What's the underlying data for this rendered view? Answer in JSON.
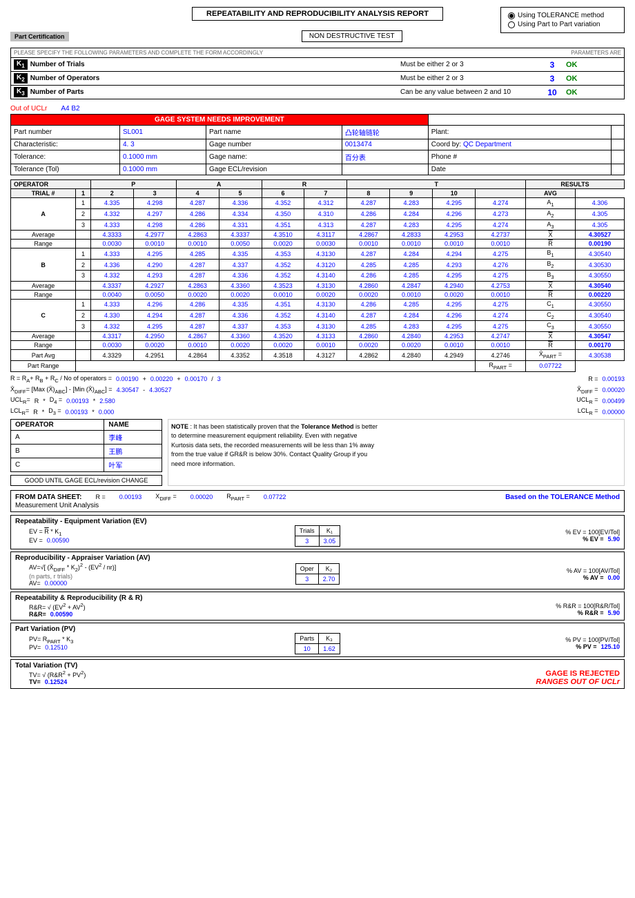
{
  "header": {
    "title": "REPEATABILITY AND REPRODUCIBILITY ANALYSIS REPORT",
    "ndt_label": "NON DESTRUCTIVE TEST",
    "part_cert": "Part Certification"
  },
  "radio_options": {
    "option1": "Using TOLERANCE method",
    "option2": "Using Part to Part variation",
    "selected": "option1"
  },
  "params_header": {
    "left": "PLEASE SPECIFY THE FOLLOWING PARAMETERS AND COMPLETE THE FORM ACCORDINGLY",
    "right": "PARAMETERS ARE"
  },
  "parameters": [
    {
      "k": "K",
      "sub": "1",
      "label": "Number of Trials",
      "desc": "Must be either 2 or 3",
      "value": "3",
      "status": "OK"
    },
    {
      "k": "K",
      "sub": "2",
      "label": "Number of Operators",
      "desc": "Must be either 2 or 3",
      "value": "3",
      "status": "OK"
    },
    {
      "k": "K",
      "sub": "3",
      "label": "Number of Parts",
      "desc": "Can be any value between 2 and 10",
      "value": "10",
      "status": "OK"
    }
  ],
  "info": {
    "out_of_uclr": "Out of UCLr",
    "a4b2": "A4 B2",
    "gage_needs": "GAGE SYSTEM NEEDS IMPROVEMENT",
    "part_number_label": "Part number",
    "part_number_value": "SL001",
    "part_name_label": "Part name",
    "part_name_value": "凸轮轴链轮",
    "plant_label": "Plant:",
    "plant_value": "",
    "characteristic_label": "Characteristic:",
    "characteristic_value": "4. 3",
    "gage_number_label": "Gage number",
    "gage_number_value": "0013474",
    "coord_by_label": "Coord by:",
    "coord_by_value": "QC Department",
    "tolerance_label": "Tolerance:",
    "tolerance_value": "0.1000",
    "tolerance_unit": "mm",
    "gage_name_label": "Gage name:",
    "gage_name_value": "百分表",
    "phone_label": "Phone #",
    "tolerance_tol_label": "Tolerance (Tol)",
    "tolerance_tol_value": "0.1000",
    "tolerance_tol_unit": "mm",
    "gage_ecl_label": "Gage ECL/revision",
    "date_label": "Date"
  },
  "table": {
    "operator_label": "OPERATOR",
    "operators": [
      "P",
      "A",
      "R",
      "T"
    ],
    "trial_label": "TRIAL #",
    "cols": [
      "1",
      "2",
      "3",
      "4",
      "5",
      "6",
      "7",
      "8",
      "9",
      "10"
    ],
    "results_label": "RESULTS",
    "avg_label": "AVG",
    "rows_A": {
      "label": "A",
      "trial1": [
        "4.335",
        "4.298",
        "4.287",
        "4.336",
        "4.352",
        "4.312",
        "4.287",
        "4.283",
        "4.295",
        "4.274"
      ],
      "trial2": [
        "4.332",
        "4.297",
        "4.286",
        "4.334",
        "4.350",
        "4.310",
        "4.286",
        "4.284",
        "4.296",
        "4.273"
      ],
      "trial3": [
        "4.333",
        "4.298",
        "4.286",
        "4.331",
        "4.351",
        "4.313",
        "4.287",
        "4.283",
        "4.295",
        "4.274"
      ],
      "avg": [
        "4.3333",
        "4.2977",
        "4.2863",
        "4.3337",
        "4.3510",
        "4.3117",
        "4.2867",
        "4.2833",
        "4.2953",
        "4.2737"
      ],
      "range": [
        "0.0030",
        "0.0010",
        "0.0010",
        "0.0050",
        "0.0020",
        "0.0030",
        "0.0010",
        "0.0010",
        "0.0010",
        "0.0010"
      ],
      "result_labels": [
        "A₁",
        "A₂",
        "A₃",
        "X̄ₐ",
        "R̄ₐ"
      ],
      "result_values": [
        "4.306",
        "4.305",
        "4.305",
        "4.30527",
        "0.00190"
      ]
    },
    "rows_B": {
      "label": "B",
      "trial1": [
        "4.333",
        "4.295",
        "4.285",
        "4.335",
        "4.353",
        "4.3130",
        "4.287",
        "4.284",
        "4.294",
        "4.275"
      ],
      "trial2": [
        "4.336",
        "4.290",
        "4.287",
        "4.337",
        "4.352",
        "4.3120",
        "4.285",
        "4.285",
        "4.293",
        "4.276"
      ],
      "trial3": [
        "4.332",
        "4.293",
        "4.287",
        "4.336",
        "4.352",
        "4.3140",
        "4.286",
        "4.285",
        "4.295",
        "4.275"
      ],
      "avg": [
        "4.3337",
        "4.2927",
        "4.2863",
        "4.3360",
        "4.3523",
        "4.3130",
        "4.2860",
        "4.2847",
        "4.2940",
        "4.2753"
      ],
      "range": [
        "0.0040",
        "0.0050",
        "0.0020",
        "0.0020",
        "0.0010",
        "0.0020",
        "0.0020",
        "0.0010",
        "0.0020",
        "0.0010"
      ],
      "result_labels": [
        "B₁",
        "B₂",
        "B₃",
        "X̄ᵦ",
        "R̄ᵦ"
      ],
      "result_values": [
        "4.30540",
        "4.30530",
        "4.30550",
        "4.30540",
        "0.00220"
      ]
    },
    "rows_C": {
      "label": "C",
      "trial1": [
        "4.333",
        "4.296",
        "4.286",
        "4.335",
        "4.351",
        "4.3130",
        "4.286",
        "4.285",
        "4.295",
        "4.275"
      ],
      "trial2": [
        "4.330",
        "4.294",
        "4.287",
        "4.336",
        "4.352",
        "4.3140",
        "4.287",
        "4.284",
        "4.296",
        "4.274"
      ],
      "trial3": [
        "4.332",
        "4.295",
        "4.287",
        "4.337",
        "4.353",
        "4.3130",
        "4.285",
        "4.283",
        "4.295",
        "4.275"
      ],
      "avg": [
        "4.3317",
        "4.2950",
        "4.2867",
        "4.3360",
        "4.3520",
        "4.3133",
        "4.2860",
        "4.2840",
        "4.2953",
        "4.2747"
      ],
      "range": [
        "0.0030",
        "0.0020",
        "0.0010",
        "0.0020",
        "0.0020",
        "0.0010",
        "0.0020",
        "0.0020",
        "0.0010",
        "0.0010"
      ],
      "result_labels": [
        "C₁",
        "C₂",
        "C₃",
        "X̄꜀",
        "R̄꜀"
      ],
      "result_values": [
        "4.30550",
        "4.30540",
        "4.30550",
        "4.30547",
        "0.00170"
      ]
    },
    "part_avg": [
      "4.3329",
      "4.2951",
      "4.2864",
      "4.3352",
      "4.3518",
      "4.3127",
      "4.2862",
      "4.2840",
      "4.2949",
      "4.2746"
    ],
    "part_avg_label": "Part Avg",
    "part_range_label": "Part Range",
    "xpart_label": "X̄PART =",
    "xpart_value": "4.30538",
    "rpart_label": "RPART =",
    "rpart_value": "0.07722"
  },
  "formulas": {
    "r_formula": "R = RA+ RB + RC / No of operators = ",
    "r_value": "0.00190",
    "plus1": "+",
    "r_value2": "0.00220",
    "plus2": "+",
    "r_value3": "0.00170",
    "div": "/",
    "div_num": "3",
    "r_result_label": "R =",
    "r_result": "0.00193",
    "xdiff_formula": "X̄DIFF= [Max (X̄)ABC] - [Min (X̄)ABC] = ",
    "xdiff_val1": "4.30547",
    "xdiff_minus": "-",
    "xdiff_val2": "4.30527",
    "xdiff_label": "X̄DIFF =",
    "xdiff_result": "0.00020",
    "uclr_formula_label": "UCLR=",
    "uclr_r": "R",
    "uclr_star": "*",
    "uclr_d4": "D₄ =",
    "uclr_d4_val": "0.00193",
    "uclr_star2": "*",
    "uclr_2580": "2.580",
    "uclr_result_label": "UCLR =",
    "uclr_result": "0.00499",
    "lclr_formula_label": "LCLR=",
    "lclr_r": "R",
    "lclr_star": "*",
    "lclr_d3": "D₃ =",
    "lclr_d3_val": "0.00193",
    "lclr_star2": "*",
    "lclr_0": "0.000",
    "lclr_result_label": "LCLR =",
    "lclr_result": "0.00000"
  },
  "operators_table": {
    "header_operator": "OPERATOR",
    "header_name": "NAME",
    "rows": [
      {
        "op": "A",
        "name": "李峰"
      },
      {
        "op": "B",
        "name": "王鹏"
      },
      {
        "op": "C",
        "name": "叶军"
      }
    ],
    "good_until": "GOOD UNTIL GAGE ECL/revision CHANGE"
  },
  "note": {
    "label": "NOTE",
    "text1": ": It has been statistically proven that the ",
    "tolerance_method": "Tolerance Method",
    "text2": " is better",
    "text3": "to determine measurement equipment reliability. Even with negative",
    "text4": "Kurtosis data sets, the recorded measurements will be less than 1% away",
    "text5": "from the true value if GR&R is below 30%. Contact Quality Group if you",
    "text6": "need more information."
  },
  "from_data": {
    "label": "FROM DATA SHEET:",
    "r_label": "R =",
    "r_value": "0.00193",
    "xdiff_label": "XDIFF =",
    "xdiff_value": "0.00020",
    "rpart_label": "RPART =",
    "rpart_value": "0.07722",
    "mua_label": "Measurement Unit Analysis",
    "tolerance_label": "Based on the TOLERANCE Method"
  },
  "ev_section": {
    "title": "Repeatability - Equipment Variation (EV)",
    "formula1": "EV = R̄ * K₁",
    "formula2_label": "EV =",
    "formula2_value": "0.00590",
    "percent_label": "% EV = 100[EV/Tol]",
    "percent_label2": "% EV =",
    "percent_value": "5.90",
    "trials_label": "Trials",
    "k1_label": "K₁",
    "trials_value": "3",
    "k1_value": "3.05"
  },
  "av_section": {
    "title": "Reproducibility - Appraiser Variation (AV)",
    "formula1": "AV=√[ (X̄DIFF * K₂)² - (EV² / nr)]",
    "n_parts_label": "(n parts, r trials)",
    "formula2_label": "AV=",
    "formula2_value": "0.00000",
    "percent_label": "% AV = 100[AV/Tol]",
    "percent_label2": "% AV =",
    "percent_value": "0.00",
    "oper_label": "Oper",
    "k2_label": "K₂",
    "oper_value": "3",
    "k2_value": "2.70"
  },
  "rnr_section": {
    "title": "Repeatability & Reproducibility (R & R)",
    "formula1": "R&R= √ (EV² + AV²)",
    "formula2_label": "R&R=",
    "formula2_value": "0.00590",
    "percent_label": "% R&R = 100[R&R/Tol]",
    "percent_label2": "% R&R =",
    "percent_value": "5.90"
  },
  "pv_section": {
    "title": "Part Variation (PV)",
    "formula1": "PV= RPART * K₃",
    "formula2_label": "PV=",
    "formula2_value": "0.12510",
    "percent_label": "% PV = 100[PV/Tol]",
    "percent_label2": "% PV =",
    "percent_value": "125.10",
    "parts_label": "Parts",
    "k3_label": "K₃",
    "parts_value": "10",
    "k3_value": "1.62"
  },
  "tv_section": {
    "title": "Total Variation (TV)",
    "formula1": "TV= √ (R&R² + PV²)",
    "formula2_label": "TV=",
    "formula2_value": "0.12524",
    "rejected_label": "GAGE IS REJECTED",
    "ranges_label": "RANGES OUT OF UCLr"
  }
}
